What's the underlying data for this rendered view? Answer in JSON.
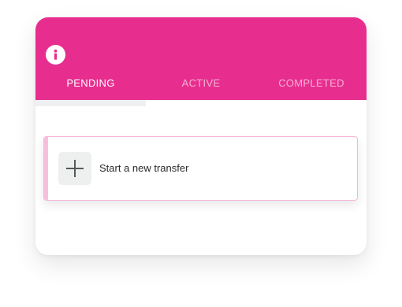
{
  "header": {
    "info_icon": "info-icon",
    "background_color": "#E72E8E"
  },
  "tabs": [
    {
      "label": "PENDING",
      "active": true
    },
    {
      "label": "ACTIVE",
      "active": false
    },
    {
      "label": "COMPLETED",
      "active": false
    }
  ],
  "transfer_list": {
    "new_transfer_label": "Start a new transfer",
    "new_transfer_icon": "plus-icon",
    "accent_color": "#F8BFDC"
  }
}
